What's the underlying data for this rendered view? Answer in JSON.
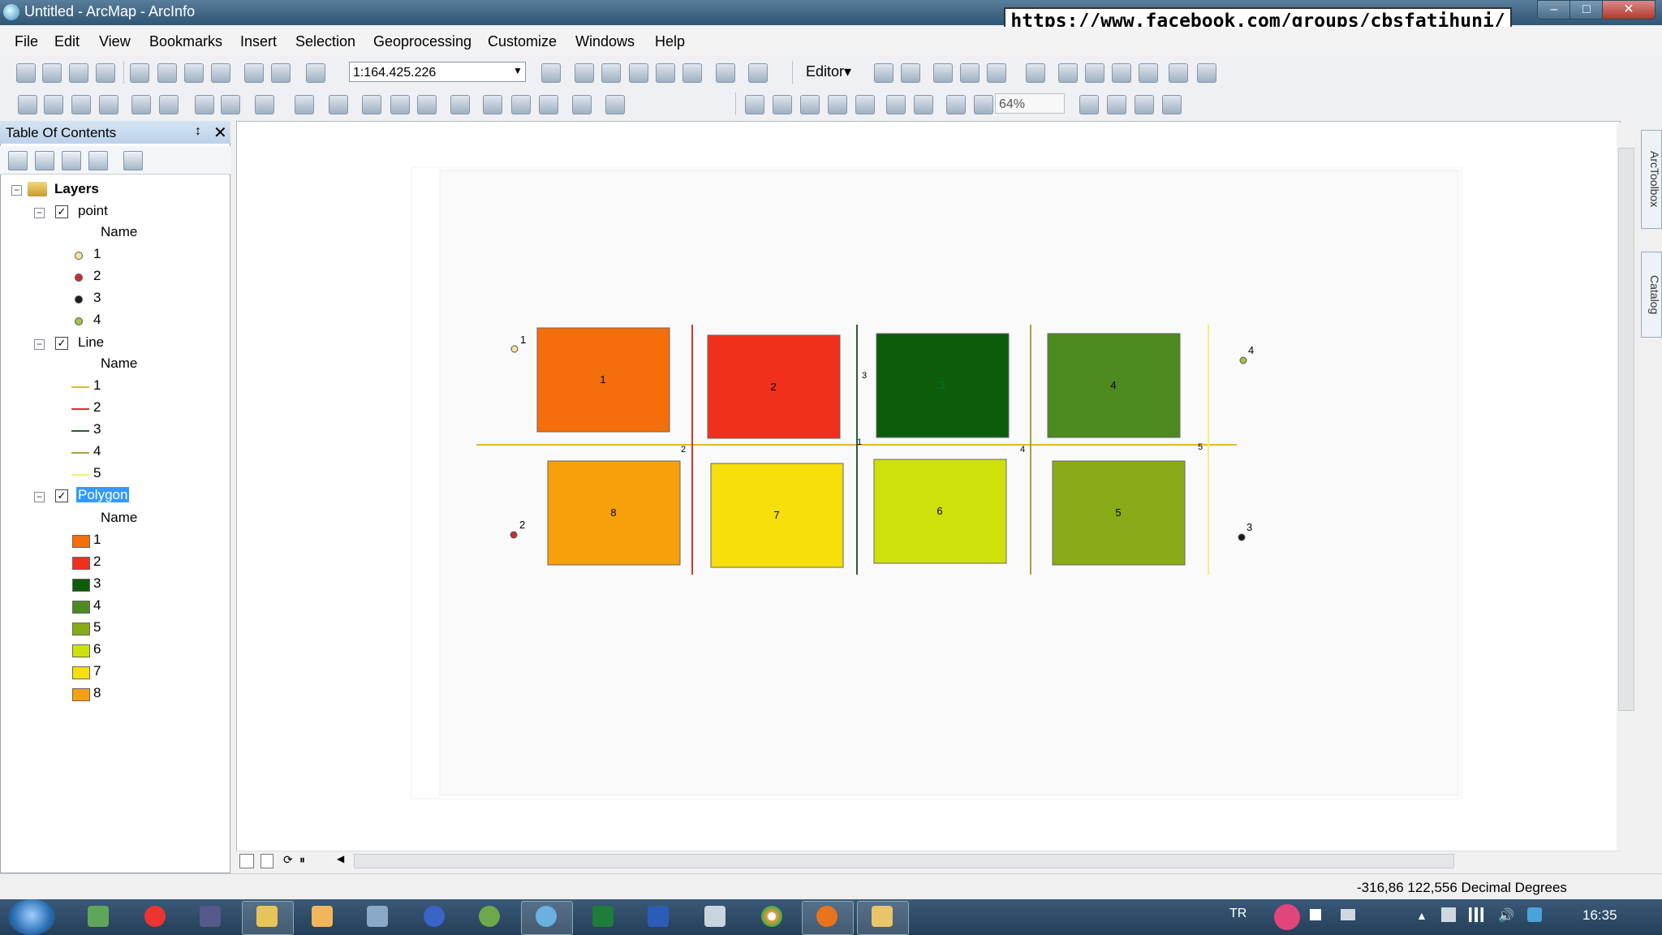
{
  "window": {
    "title": "Untitled - ArcMap - ArcInfo",
    "url_banner": "https://www.facebook.com/groups/cbsfatihuni/",
    "controls": {
      "minimize": "–",
      "maximize": "□",
      "close": "✕"
    }
  },
  "menu": [
    "File",
    "Edit",
    "View",
    "Bookmarks",
    "Insert",
    "Selection",
    "Geoprocessing",
    "Customize",
    "Windows",
    "Help"
  ],
  "toolbar": {
    "scale": "1:164.425.226",
    "editor_label": "Editor▾",
    "zoom_level": "64%"
  },
  "toc": {
    "title": "Table Of Contents",
    "pin_icon": "↕",
    "close_icon": "✕",
    "root": "Layers",
    "layers": [
      {
        "name": "point",
        "field": "Name",
        "items": [
          {
            "label": "1",
            "color": "#f2e39b"
          },
          {
            "label": "2",
            "color": "#cc2b2b"
          },
          {
            "label": "3",
            "color": "#1b1b1b"
          },
          {
            "label": "4",
            "color": "#a3c24a"
          }
        ]
      },
      {
        "name": "Line",
        "field": "Name",
        "items": [
          {
            "label": "1",
            "color": "#e6b430"
          },
          {
            "label": "2",
            "color": "#d9352b"
          },
          {
            "label": "3",
            "color": "#2e5e2e"
          },
          {
            "label": "4",
            "color": "#a8a040"
          },
          {
            "label": "5",
            "color": "#f2ee7a"
          }
        ]
      },
      {
        "name": "Polygon",
        "field": "Name",
        "items": [
          {
            "label": "1",
            "color": "#f46e0c"
          },
          {
            "label": "2",
            "color": "#f0301c"
          },
          {
            "label": "3",
            "color": "#0c5c0c"
          },
          {
            "label": "4",
            "color": "#4d8a1f"
          },
          {
            "label": "5",
            "color": "#88ac18"
          },
          {
            "label": "6",
            "color": "#cfe10a"
          },
          {
            "label": "7",
            "color": "#f6df0a"
          },
          {
            "label": "8",
            "color": "#f7a00c"
          }
        ]
      }
    ]
  },
  "map": {
    "polygons": [
      {
        "label": "1",
        "color": "#f46e0c"
      },
      {
        "label": "2",
        "color": "#f0301c"
      },
      {
        "label": "3",
        "color": "#0c5c0c"
      },
      {
        "label": "4",
        "color": "#4d8a1f"
      },
      {
        "label": "8",
        "color": "#f7a00c"
      },
      {
        "label": "7",
        "color": "#f6df0a"
      },
      {
        "label": "6",
        "color": "#cfe10a"
      },
      {
        "label": "5",
        "color": "#88ac18"
      }
    ],
    "point_labels": [
      "1",
      "2",
      "3",
      "4"
    ],
    "line_labels": [
      "1",
      "2",
      "3",
      "4",
      "5"
    ]
  },
  "dock_tabs": {
    "toolbox": "ArcToolbox",
    "catalog": "Catalog"
  },
  "status": {
    "coordinates": "-316,86  122,556 Decimal Degrees"
  },
  "taskbar": {
    "language": "TR",
    "time": "16:35"
  }
}
